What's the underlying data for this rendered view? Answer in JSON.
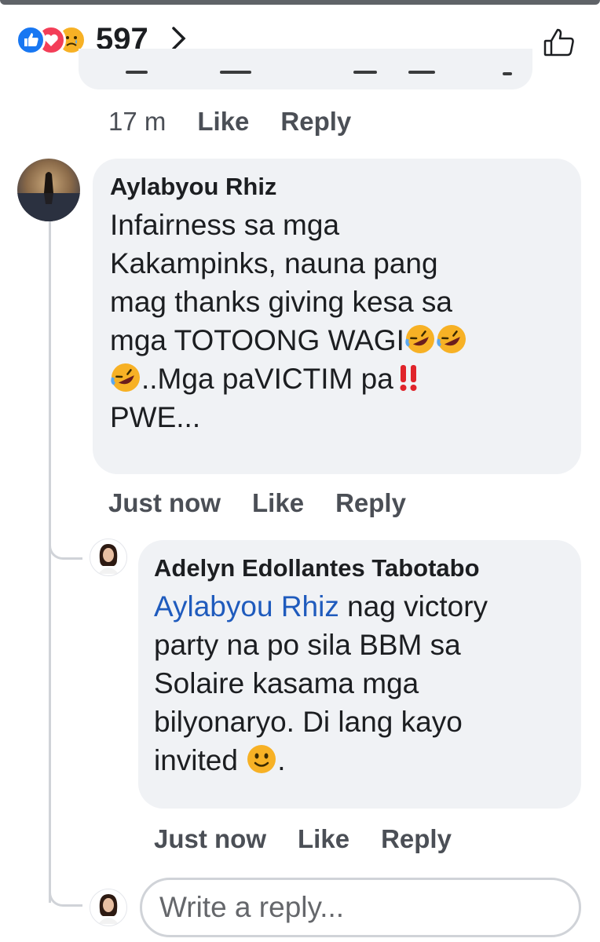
{
  "header": {
    "reaction_count": "597",
    "reaction_icons": [
      "like-icon",
      "love-icon",
      "sad-icon"
    ],
    "like_icon": "thumbs-up-outline-icon"
  },
  "previous_comment": {
    "time": "17 m",
    "like_label": "Like",
    "reply_label": "Reply"
  },
  "comments": [
    {
      "author": "Aylabyou Rhiz",
      "text_parts": [
        "Infairness sa mga",
        "Kakampinks, nauna pang",
        "mag thanks giving kesa sa",
        "mga TOTOONG WAGI",
        "..Mga paVICTIM pa",
        "PWE..."
      ],
      "time": "Just now",
      "like_label": "Like",
      "reply_label": "Reply"
    },
    {
      "author": "Adelyn Edollantes Tabotabo",
      "mention": "Aylabyou Rhiz",
      "text_parts": [
        " nag victory",
        "party na po sila BBM sa",
        "Solaire kasama mga",
        "bilyonaryo.  Di lang kayo",
        "invited",
        "."
      ],
      "time": "Just now",
      "like_label": "Like",
      "reply_label": "Reply"
    }
  ],
  "reply_box": {
    "placeholder": "Write a reply..."
  },
  "colors": {
    "bubble": "#f0f2f5",
    "mention": "#1f5bbd",
    "meta": "#4b4f56"
  }
}
